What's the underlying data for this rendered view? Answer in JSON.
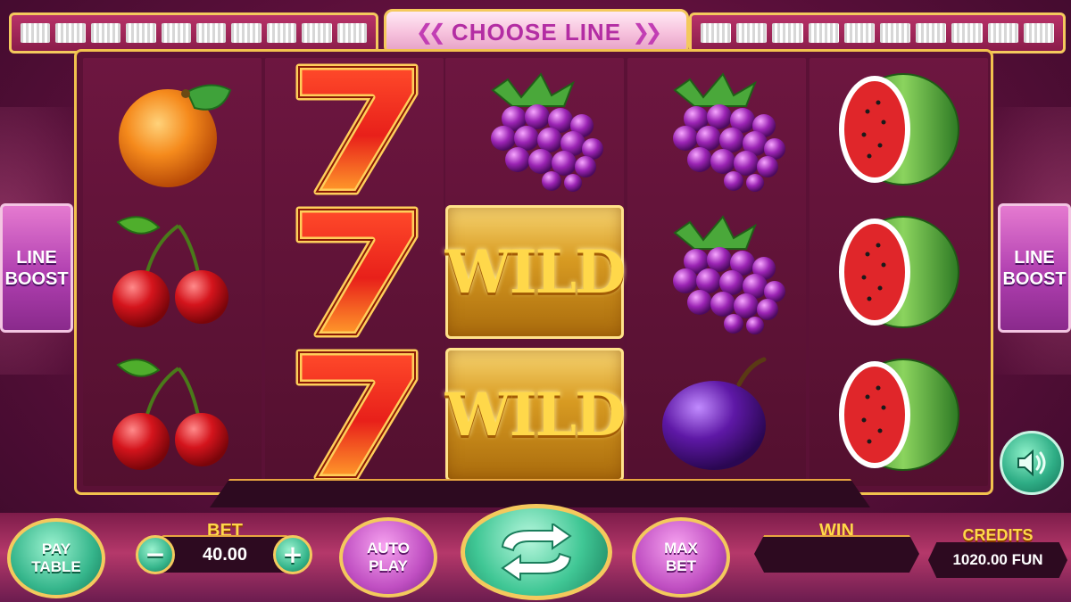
{
  "top_bar": {
    "title": "CHOOSE LINE",
    "left_arrow_icon": "double-chevron-left-icon",
    "right_arrow_icon": "double-chevron-right-icon",
    "left_line_count": 10,
    "right_line_count": 10
  },
  "side_buttons": {
    "left": {
      "line1": "LINE",
      "line2": "BOOST"
    },
    "right": {
      "line1": "LINE",
      "line2": "BOOST"
    }
  },
  "reels": [
    [
      "orange",
      "cherry",
      "cherry"
    ],
    [
      "seven",
      "seven",
      "seven"
    ],
    [
      "grapes",
      "wild",
      "wild"
    ],
    [
      "grapes",
      "grapes",
      "plum"
    ],
    [
      "watermelon",
      "watermelon",
      "watermelon"
    ]
  ],
  "wild_text": "WILD",
  "controls": {
    "paytable": {
      "line1": "PAY",
      "line2": "TABLE"
    },
    "bet": {
      "label": "BET",
      "value": "40.00",
      "minus_icon": "minus-icon",
      "plus_icon": "plus-icon"
    },
    "autoplay": {
      "line1": "AUTO",
      "line2": "PLAY"
    },
    "spin": {
      "icon": "refresh-arrows-icon"
    },
    "maxbet": {
      "line1": "MAX",
      "line2": "BET"
    },
    "win": {
      "label": "WIN",
      "value": ""
    },
    "credits": {
      "label": "CREDITS",
      "value": "1020.00 FUN"
    },
    "sound": {
      "icon": "speaker-icon"
    }
  },
  "colors": {
    "gold": "#f4c95d",
    "background": "#5a0f3a",
    "green_button": "#36b68c",
    "purple_button": "#c04fc2"
  }
}
